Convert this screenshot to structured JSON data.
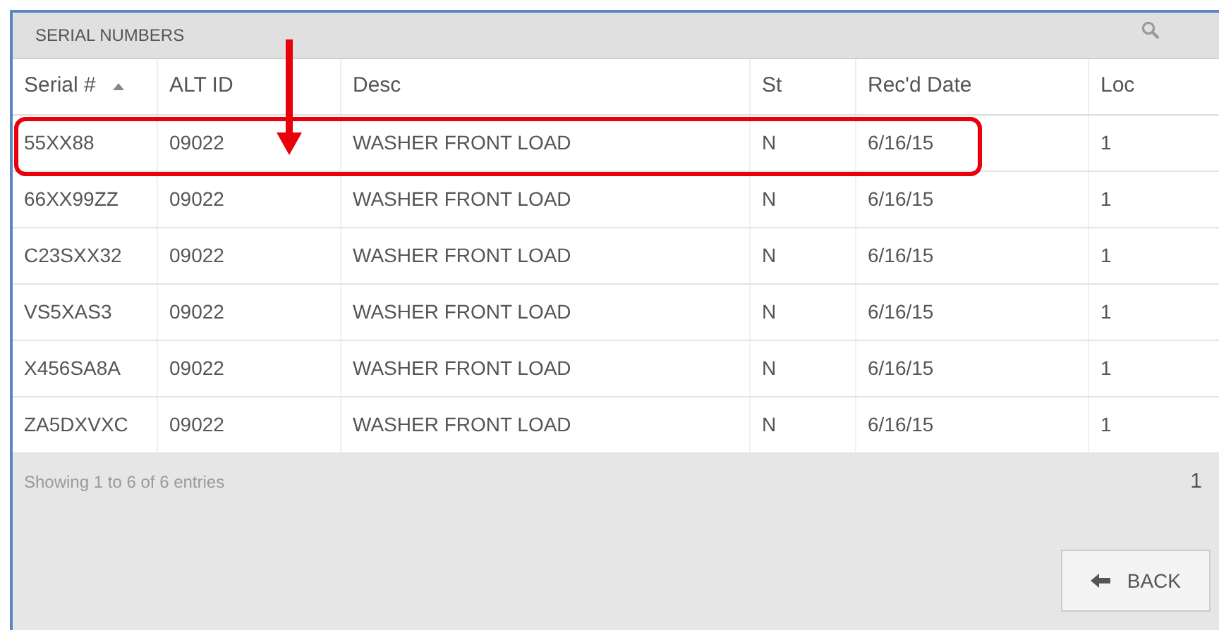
{
  "panel": {
    "title": "SERIAL NUMBERS"
  },
  "table": {
    "columns": [
      "Serial #",
      "ALT ID",
      "Desc",
      "St",
      "Rec'd Date",
      "Loc"
    ],
    "rows": [
      [
        "55XX88",
        "09022",
        "WASHER FRONT LOAD",
        "N",
        "6/16/15",
        "1"
      ],
      [
        "66XX99ZZ",
        "09022",
        "WASHER FRONT LOAD",
        "N",
        "6/16/15",
        "1"
      ],
      [
        "C23SXX32",
        "09022",
        "WASHER FRONT LOAD",
        "N",
        "6/16/15",
        "1"
      ],
      [
        "VS5XAS3",
        "09022",
        "WASHER FRONT LOAD",
        "N",
        "6/16/15",
        "1"
      ],
      [
        "X456SA8A",
        "09022",
        "WASHER FRONT LOAD",
        "N",
        "6/16/15",
        "1"
      ],
      [
        "ZA5DXVXC",
        "09022",
        "WASHER FRONT LOAD",
        "N",
        "6/16/15",
        "1"
      ]
    ]
  },
  "footer": {
    "info": "Showing 1 to 6 of 6 entries",
    "page": "1"
  },
  "buttons": [
    {
      "label": "BACK"
    }
  ]
}
